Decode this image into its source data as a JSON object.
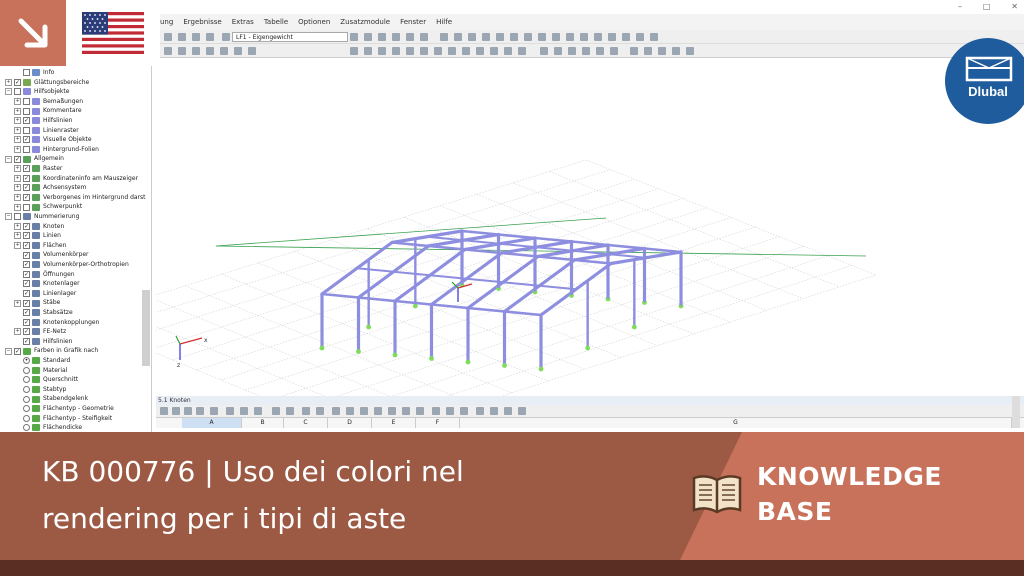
{
  "menu": {
    "items": [
      "ung",
      "Ergebnisse",
      "Extras",
      "Tabelle",
      "Optionen",
      "Zusatzmodule",
      "Fenster",
      "Hilfe"
    ],
    "window_controls": [
      "–",
      "□",
      "✕"
    ]
  },
  "toolbar": {
    "load_case_combo": "LF1 - Eigengewicht"
  },
  "navigator": {
    "items": [
      {
        "label": "Info",
        "level": 2,
        "checked": false,
        "icon": "info-icon",
        "expand": ""
      },
      {
        "label": "Glättungsbereiche",
        "level": 1,
        "checked": true,
        "icon": "smoothing-icon",
        "expand": "+"
      },
      {
        "label": "Hilfsobjekte",
        "level": 1,
        "checked": false,
        "icon": "guide-objects-icon",
        "expand": "−"
      },
      {
        "label": "Bemaßungen",
        "level": 2,
        "checked": false,
        "icon": "dimension-icon",
        "expand": "+"
      },
      {
        "label": "Kommentare",
        "level": 2,
        "checked": false,
        "icon": "comment-icon",
        "expand": "+"
      },
      {
        "label": "Hilfslinien",
        "level": 2,
        "checked": true,
        "icon": "guideline-icon",
        "expand": "+"
      },
      {
        "label": "Linienraster",
        "level": 2,
        "checked": false,
        "icon": "line-grid-icon",
        "expand": "+"
      },
      {
        "label": "Visuelle Objekte",
        "level": 2,
        "checked": true,
        "icon": "visual-object-icon",
        "expand": "+"
      },
      {
        "label": "Hintergrund-Folien",
        "level": 2,
        "checked": false,
        "icon": "background-layer-icon",
        "expand": "+"
      },
      {
        "label": "Allgemein",
        "level": 1,
        "checked": true,
        "icon": "general-icon",
        "expand": "−"
      },
      {
        "label": "Raster",
        "level": 2,
        "checked": true,
        "icon": "grid-icon",
        "expand": "+"
      },
      {
        "label": "Koordinateninfo am Mauszeiger",
        "level": 2,
        "checked": true,
        "icon": "coordinate-icon",
        "expand": "+"
      },
      {
        "label": "Achsensystem",
        "level": 2,
        "checked": true,
        "icon": "axis-icon",
        "expand": "+"
      },
      {
        "label": "Verborgenes im Hintergrund darst",
        "level": 2,
        "checked": true,
        "icon": "hidden-icon",
        "expand": "+"
      },
      {
        "label": "Schwerpunkt",
        "level": 2,
        "checked": false,
        "icon": "centroid-icon",
        "expand": "+"
      },
      {
        "label": "Nummerierung",
        "level": 1,
        "checked": false,
        "icon": "numbering-icon",
        "expand": "−"
      },
      {
        "label": "Knoten",
        "level": 2,
        "checked": true,
        "icon": "numbering-icon",
        "expand": "+"
      },
      {
        "label": "Linien",
        "level": 2,
        "checked": true,
        "icon": "numbering-icon",
        "expand": "+"
      },
      {
        "label": "Flächen",
        "level": 2,
        "checked": true,
        "icon": "numbering-icon",
        "expand": "+"
      },
      {
        "label": "Volumenkörper",
        "level": 2,
        "checked": true,
        "icon": "numbering-icon",
        "expand": ""
      },
      {
        "label": "Volumenkörper-Orthotropien",
        "level": 2,
        "checked": true,
        "icon": "numbering-icon",
        "expand": ""
      },
      {
        "label": "Öffnungen",
        "level": 2,
        "checked": true,
        "icon": "numbering-icon",
        "expand": ""
      },
      {
        "label": "Knotenlager",
        "level": 2,
        "checked": true,
        "icon": "numbering-icon",
        "expand": ""
      },
      {
        "label": "Linienlager",
        "level": 2,
        "checked": true,
        "icon": "numbering-icon",
        "expand": ""
      },
      {
        "label": "Stäbe",
        "level": 2,
        "checked": true,
        "icon": "numbering-icon",
        "expand": "+"
      },
      {
        "label": "Stabsätze",
        "level": 2,
        "checked": true,
        "icon": "numbering-icon",
        "expand": ""
      },
      {
        "label": "Knotenkopplungen",
        "level": 2,
        "checked": true,
        "icon": "numbering-icon",
        "expand": ""
      },
      {
        "label": "FE-Netz",
        "level": 2,
        "checked": true,
        "icon": "numbering-icon",
        "expand": "+"
      },
      {
        "label": "Hilfslinien",
        "level": 2,
        "checked": true,
        "icon": "numbering-icon",
        "expand": ""
      },
      {
        "label": "Farben in Grafik nach",
        "level": 1,
        "checked": true,
        "icon": "color-icon",
        "expand": "−"
      },
      {
        "label": "Standard",
        "level": 2,
        "checked": true,
        "icon": "color-icon",
        "expand": "",
        "radio": true
      },
      {
        "label": "Material",
        "level": 2,
        "checked": false,
        "icon": "color-icon",
        "expand": "",
        "radio": true
      },
      {
        "label": "Querschnitt",
        "level": 2,
        "checked": false,
        "icon": "color-icon",
        "expand": "",
        "radio": true
      },
      {
        "label": "Stabtyp",
        "level": 2,
        "checked": false,
        "icon": "color-icon",
        "expand": "",
        "radio": true
      },
      {
        "label": "Stabendgelenk",
        "level": 2,
        "checked": false,
        "icon": "color-icon",
        "expand": "",
        "radio": true
      },
      {
        "label": "Flächentyp - Geometrie",
        "level": 2,
        "checked": false,
        "icon": "color-icon",
        "expand": "",
        "radio": true
      },
      {
        "label": "Flächentyp - Steifigkeit",
        "level": 2,
        "checked": false,
        "icon": "color-icon",
        "expand": "",
        "radio": true
      },
      {
        "label": "Flächendicke",
        "level": 2,
        "checked": false,
        "icon": "color-icon",
        "expand": "",
        "radio": true
      }
    ]
  },
  "viewport": {
    "axis_label_x": "x",
    "axis_label_z": "z"
  },
  "table": {
    "title": "5.1 Knoten",
    "columns": [
      "A",
      "B",
      "C",
      "D",
      "E",
      "F",
      "G"
    ]
  },
  "banner": {
    "title_line1": "KB 000776 | Uso dei colori nel",
    "title_line2": "rendering per i tipi di aste",
    "label_line1": "KNOWLEDGE",
    "label_line2": "BASE"
  },
  "logo": {
    "text": "Dlubal"
  },
  "colors": {
    "banner": "#9c5a44",
    "banner_accent": "#c8715b",
    "member": "#8e8ee0",
    "support": "#7fdc5a",
    "logo_blue": "#1f5c9e"
  }
}
